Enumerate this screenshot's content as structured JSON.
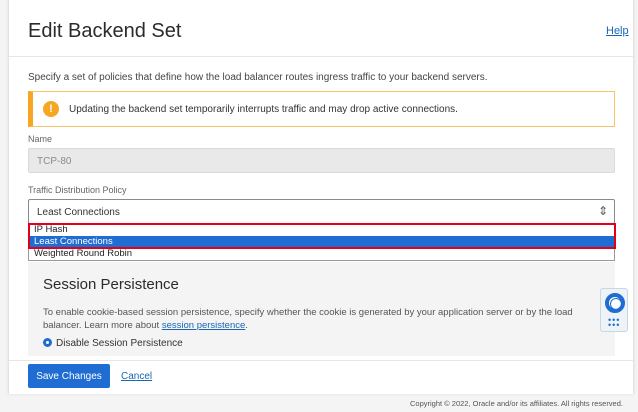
{
  "header": {
    "title": "Edit Backend Set",
    "help_label": "Help"
  },
  "intro_text": "Specify a set of policies that define how the load balancer routes ingress traffic to your backend servers.",
  "warning": {
    "icon": "!",
    "text": "Updating the backend set temporarily interrupts traffic and may drop active connections."
  },
  "name_field": {
    "label": "Name",
    "value": "TCP-80"
  },
  "policy": {
    "label": "Traffic Distribution Policy",
    "selected": "Least Connections",
    "arrow": "⇕",
    "options": [
      "IP Hash",
      "Least Connections",
      "Weighted Round Robin"
    ],
    "highlighted_option": "Least Connections"
  },
  "session": {
    "title": "Session Persistence",
    "description": "To enable cookie-based session persistence, specify whether the cookie is generated by your application server or by the load balancer. Learn more about",
    "link_text": "session persistence",
    "link_suffix": ".",
    "radio_label": "Disable Session Persistence"
  },
  "footer": {
    "save_label": "Save Changes",
    "cancel_label": "Cancel",
    "copyright": "Copyright © 2022, Oracle and/or its affiliates. All rights reserved."
  },
  "colors": {
    "primary": "#1f6dd2",
    "warning": "#f6a623",
    "highlight_border": "#e0001b"
  }
}
